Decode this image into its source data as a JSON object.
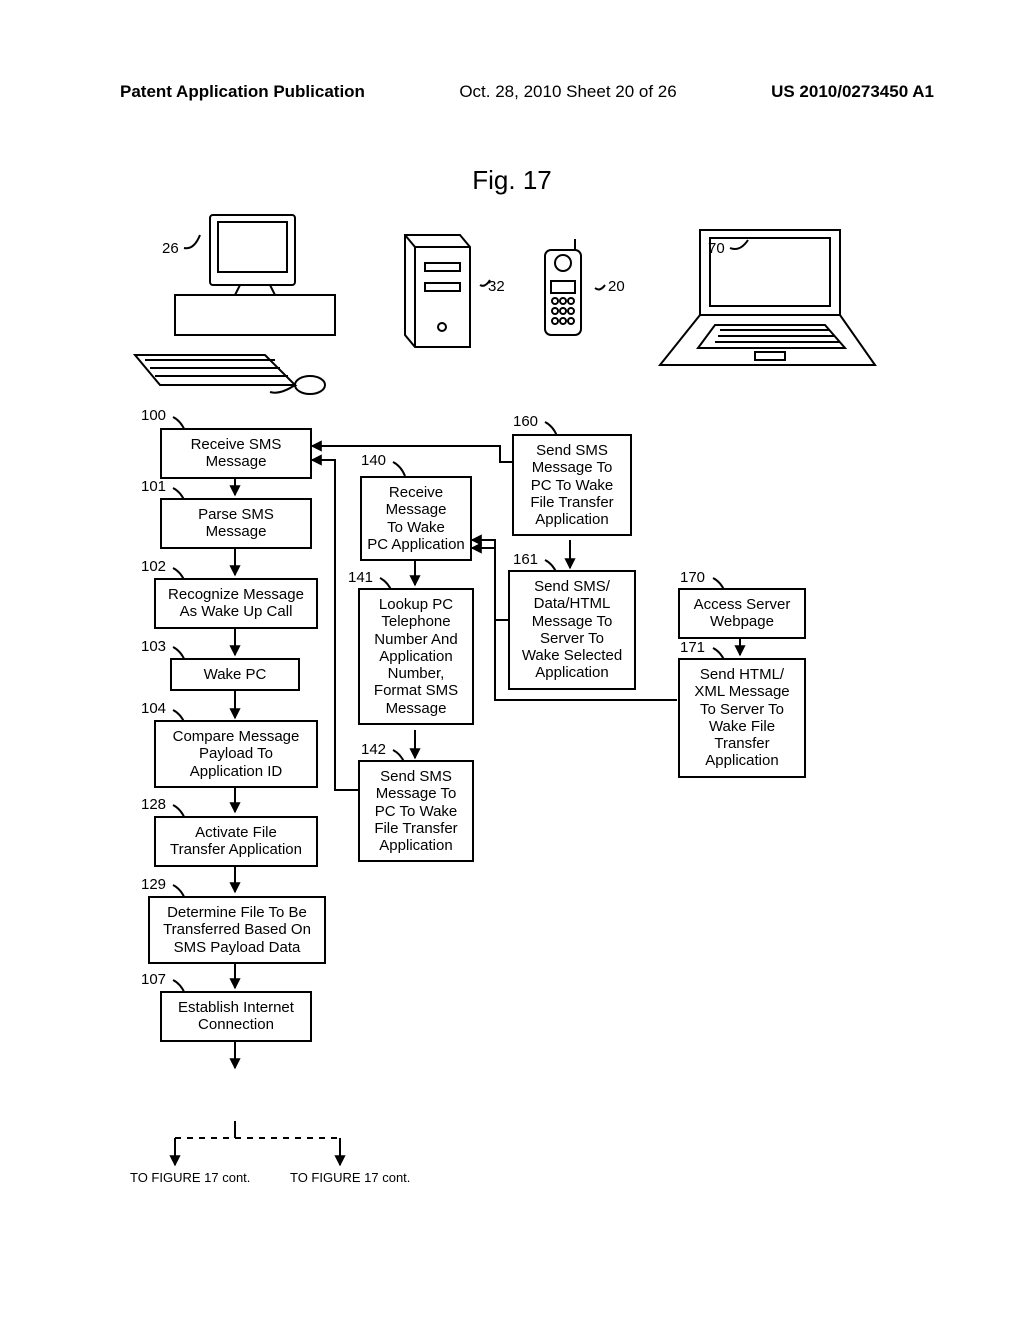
{
  "header": {
    "left": "Patent Application Publication",
    "mid": "Oct. 28, 2010  Sheet 20 of 26",
    "right": "US 2010/0273450 A1"
  },
  "figure_title": "Fig. 17",
  "refs": {
    "r26": "26",
    "r32": "32",
    "r20": "20",
    "r70": "70",
    "r100": "100",
    "r101": "101",
    "r102": "102",
    "r103": "103",
    "r104": "104",
    "r128": "128",
    "r129": "129",
    "r107": "107",
    "r140": "140",
    "r141": "141",
    "r142": "142",
    "r160": "160",
    "r161": "161",
    "r170": "170",
    "r171": "171"
  },
  "boxes": {
    "b100": "Receive SMS\nMessage",
    "b101": "Parse SMS\nMessage",
    "b102": "Recognize Message\nAs Wake Up Call",
    "b103": "Wake PC",
    "b104": "Compare Message\nPayload To\nApplication ID",
    "b128": "Activate File\nTransfer Application",
    "b129": "Determine File To Be\nTransferred Based On\nSMS Payload Data",
    "b107": "Establish Internet\nConnection",
    "b140": "Receive\nMessage\nTo Wake\nPC Application",
    "b141": "Lookup PC\nTelephone\nNumber And\nApplication\nNumber,\nFormat SMS\nMessage",
    "b142": "Send SMS\nMessage To\nPC To Wake\nFile Transfer\nApplication",
    "b160": "Send SMS\nMessage To\nPC To Wake\nFile Transfer\nApplication",
    "b161": "Send SMS/\nData/HTML\nMessage To\nServer To\nWake Selected\nApplication",
    "b170": "Access Server\nWebpage",
    "b171": "Send HTML/\nXML Message\nTo Server To\nWake File\nTransfer\nApplication"
  },
  "footnotes": {
    "left": "TO FIGURE 17 cont.",
    "right": "TO FIGURE 17 cont."
  }
}
